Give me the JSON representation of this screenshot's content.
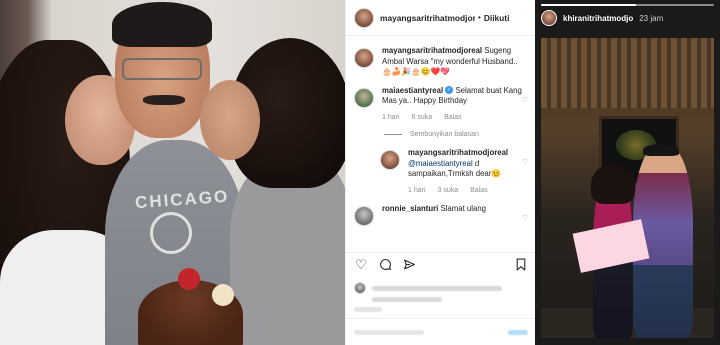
{
  "post": {
    "header": {
      "username": "mayangsaritrihatmodjoreal",
      "dot": "•",
      "follow_status": "Diikuti"
    },
    "comments": [
      {
        "username": "mayangsaritrihatmodjoreal",
        "text": "Sugeng Ambal Warsa \"my wonderful Husband..🎂🍰🎉🎂😊❤️💖"
      },
      {
        "username": "maiaestiantyreal",
        "verified": true,
        "text": "Selamat buat Kang Mas ya.. Happy Birthday",
        "time": "1 hari",
        "likes": "6 suka",
        "reply_label": "Balas"
      }
    ],
    "hide_replies": "Sembunyikan balasan",
    "reply": {
      "username": "mayangsaritrihatmodjoreal",
      "mention": "@maiaestiantyreal",
      "text": "d sampaikan,Trmksh dear😊",
      "time": "1 hari",
      "likes": "3 suka",
      "reply_label": "Balas"
    },
    "next_comment": {
      "username": "ronnie_sianturi",
      "text": "Slamat ulang"
    },
    "actions": {
      "like_icon": "heart-icon",
      "comment_icon": "comment-icon",
      "share_icon": "share-icon",
      "save_icon": "bookmark-icon"
    }
  },
  "story": {
    "username": "khiranitrihatmodjo",
    "time": "23 jam",
    "progress": 0.55
  },
  "photo": {
    "shirt_text": "CHICAGO"
  }
}
